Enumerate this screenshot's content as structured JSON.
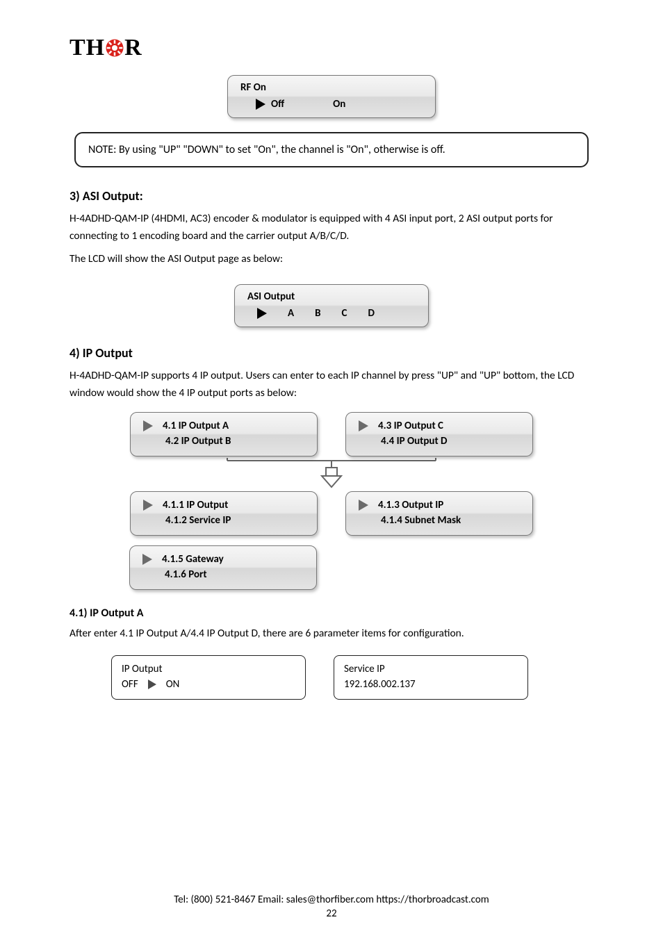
{
  "logo": {
    "part1": "TH",
    "part2": "R"
  },
  "lcd_rf": {
    "title": "RF On",
    "opt_off": "Off",
    "opt_on": "On"
  },
  "note": "NOTE: By using \"UP\" \"DOWN\" to set \"On\", the channel is \"On\", otherwise is off.",
  "sec3": {
    "h": "3) ASI Output:",
    "p1": "H-4ADHD-QAM-IP (4HDMI, AC3) encoder & modulator is equipped with 4 ASI input port, 2 ASI output ports for connecting to 1 encoding board and the carrier output A/B/C/D.",
    "p2": "The LCD will show the ASI Output page as below:"
  },
  "lcd_asi": {
    "title": "ASI Output",
    "a": "A",
    "b": "B",
    "c": "C",
    "d": "D"
  },
  "sec4": {
    "h": "4) IP Output",
    "p1": "H-4ADHD-QAM-IP supports 4 IP output. Users can enter to each IP channel by press \"UP\" and \"UP\" bottom, the LCD window would show the 4 IP output ports as below:"
  },
  "menu_top_left": {
    "l1": "4.1 IP Output A",
    "l2": "4.2 IP Output B"
  },
  "menu_top_right": {
    "l1": "4.3 IP Output C",
    "l2": "4.4 IP Output D"
  },
  "menu_mid_left": {
    "l1": "4.1.1 IP Output",
    "l2": "4.1.2 Service IP"
  },
  "menu_mid_right": {
    "l1": "4.1.3 Output IP",
    "l2": "4.1.4 Subnet Mask"
  },
  "menu_bot_left": {
    "l1": "4.1.5 Gateway",
    "l2": "4.1.6 Port"
  },
  "sec41": {
    "h": "4.1) IP Output A",
    "p": "After enter 4.1 IP Output A/4.4 IP Output D, there are 6 parameter items for configuration."
  },
  "box_ip_output": {
    "title": "IP Output",
    "off": "OFF",
    "on": "ON"
  },
  "box_service_ip": {
    "title": "Service IP",
    "value": "192.168.002.137"
  },
  "footer": {
    "l1": "Tel: (800) 521-8467      Email: sales@thorfiber.com      https://thorbroadcast.com",
    "l2": "22"
  }
}
